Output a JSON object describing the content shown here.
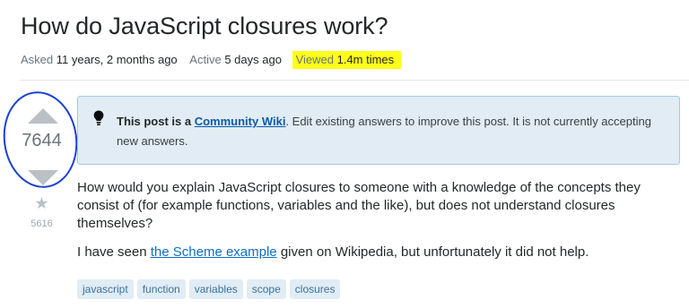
{
  "question": {
    "title": "How do JavaScript closures work?",
    "meta": {
      "asked_label": "Asked",
      "asked_value": "11 years, 2 months ago",
      "active_label": "Active",
      "active_value": "5 days ago",
      "viewed_label": "Viewed",
      "viewed_value": "1.4m times",
      "highlight_color": "#ffff1a"
    },
    "votes": {
      "score": "7644",
      "favorites": "5616",
      "annotation_circle_color": "#1b3fd6"
    },
    "notice": {
      "lead": "This post is a",
      "link": "Community Wiki",
      "rest": ". Edit existing answers to improve this post. It is not currently accepting new answers.",
      "icon": "lightbulb-icon"
    },
    "body": {
      "paragraph1": "How would you explain JavaScript closures to someone with a knowledge of the concepts they consist of (for example functions, variables and the like), but does not understand closures themselves?",
      "p2_before": "I have seen ",
      "p2_link": "the Scheme example",
      "p2_after": " given on Wikipedia, but unfortunately it did not help."
    },
    "tags": [
      "javascript",
      "function",
      "variables",
      "scope",
      "closures"
    ]
  }
}
